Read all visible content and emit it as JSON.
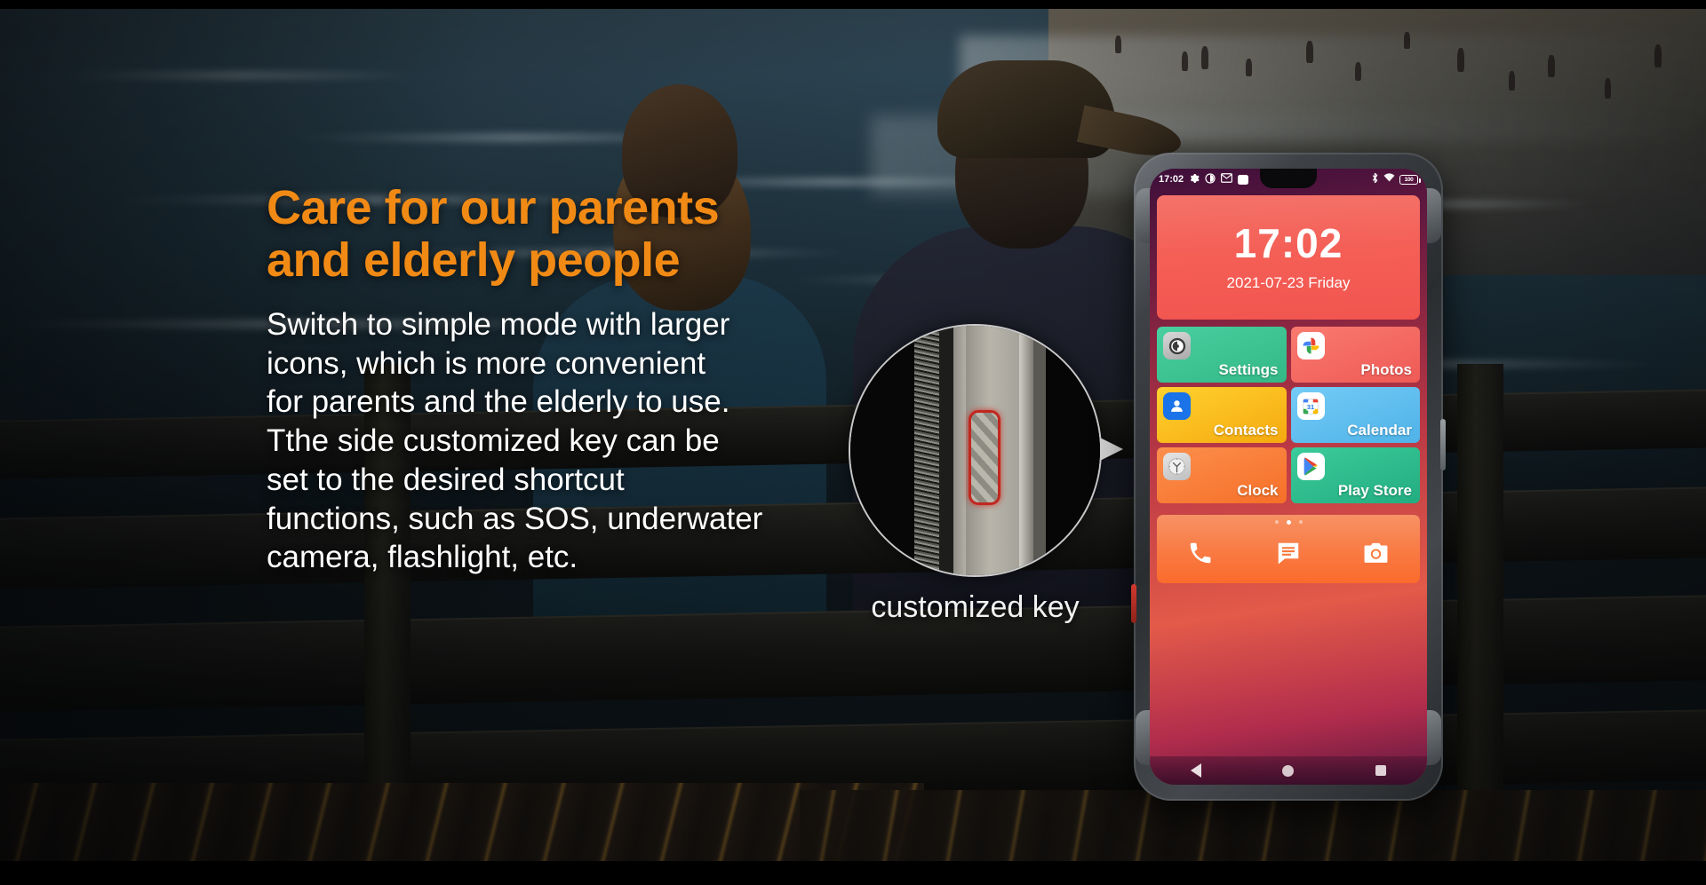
{
  "headline": {
    "line1": "Care for our parents",
    "line2": "and elderly people",
    "color": "#F18A15"
  },
  "body_lines": [
    "Switch to simple mode with larger",
    "icons, which is more convenient",
    "for parents and the elderly to use.",
    "Tthe side customized key can be",
    "set to the desired shortcut",
    "functions, such as SOS, underwater",
    "camera, flashlight, etc."
  ],
  "magnifier": {
    "caption": "customized key",
    "highlight_color": "#c0271f"
  },
  "phone": {
    "status_bar": {
      "time": "17:02",
      "left_icons": [
        "gear-icon",
        "brightness-icon",
        "mail-icon",
        "app-square-icon"
      ],
      "right_icons": [
        "bluetooth-icon",
        "wifi-icon"
      ],
      "battery_level": "100"
    },
    "clock_widget": {
      "time": "17:02",
      "date": "2021-07-23 Friday"
    },
    "tiles": [
      {
        "label": "Settings",
        "icon": "settings-gear-icon",
        "bg": "#3ec596",
        "icon_style": "ic-settings"
      },
      {
        "label": "Photos",
        "icon": "google-photos-icon",
        "bg": "#f4665e",
        "icon_style": "ic-white"
      },
      {
        "label": "Contacts",
        "icon": "contacts-person-icon",
        "bg": "#fbc117",
        "icon_style": "ic-contacts"
      },
      {
        "label": "Calendar",
        "icon": "google-calendar-icon",
        "bg": "#5dbcf0",
        "icon_style": "ic-white"
      },
      {
        "label": "Clock",
        "icon": "analog-clock-icon",
        "bg": "#f9813f",
        "icon_style": "ic-clock"
      },
      {
        "label": "Play Store",
        "icon": "google-play-icon",
        "bg": "#2dbd8e",
        "icon_style": "ic-white"
      }
    ],
    "dock": {
      "icons": [
        "phone-icon",
        "messages-icon",
        "camera-icon"
      ],
      "page_dots": 3,
      "active_dot": 2
    },
    "nav_bar": [
      "back-icon",
      "home-icon",
      "recents-icon"
    ]
  }
}
